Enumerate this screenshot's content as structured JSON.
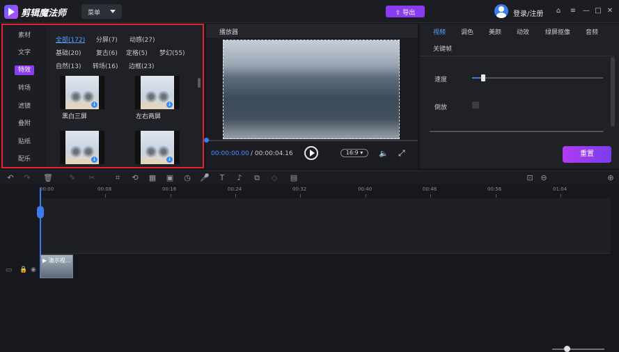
{
  "app": {
    "title": "剪辑魔法师",
    "menu_label": "菜单",
    "export_label": "导出",
    "login_label": "登录/注册"
  },
  "left_panel": {
    "categories": [
      "素材",
      "文字",
      "特效",
      "转场",
      "滤镜",
      "叠附",
      "贴纸",
      "配乐"
    ],
    "active_category": "特效",
    "subcategories": [
      [
        "全部(172)",
        "分屏(7)",
        "动感(27)"
      ],
      [
        "基础(20)",
        "复古(6)",
        "定格(5)",
        "梦幻(55)"
      ],
      [
        "自然(13)",
        "转场(16)",
        "边框(23)"
      ]
    ],
    "effects": [
      {
        "label": "黑白三屏"
      },
      {
        "label": "左右两屏"
      },
      {
        "label": ""
      },
      {
        "label": ""
      }
    ]
  },
  "player": {
    "title": "播放器",
    "current_time": "00:00:00.00",
    "total_time": " / 00:00:04.16",
    "aspect_ratio": "16:9"
  },
  "right_panel": {
    "tabs": [
      "视频",
      "调色",
      "美颜",
      "动效",
      "绿屏抠像",
      "音频"
    ],
    "tab_row2": "关键帧",
    "active_tab": "视频",
    "speed_label": "速度",
    "reverse_label": "倒放",
    "reset_label": "重置"
  },
  "timeline": {
    "ticks": [
      "00:00",
      "00:08",
      "00:16",
      "00:24",
      "00:32",
      "00:40",
      "00:48",
      "00:56",
      "01:04"
    ],
    "clip_label": "演示视..."
  },
  "colors": {
    "accent_purple": "#8a3cf0",
    "accent_blue": "#3d7bf0",
    "highlight_red": "#e0262a"
  }
}
